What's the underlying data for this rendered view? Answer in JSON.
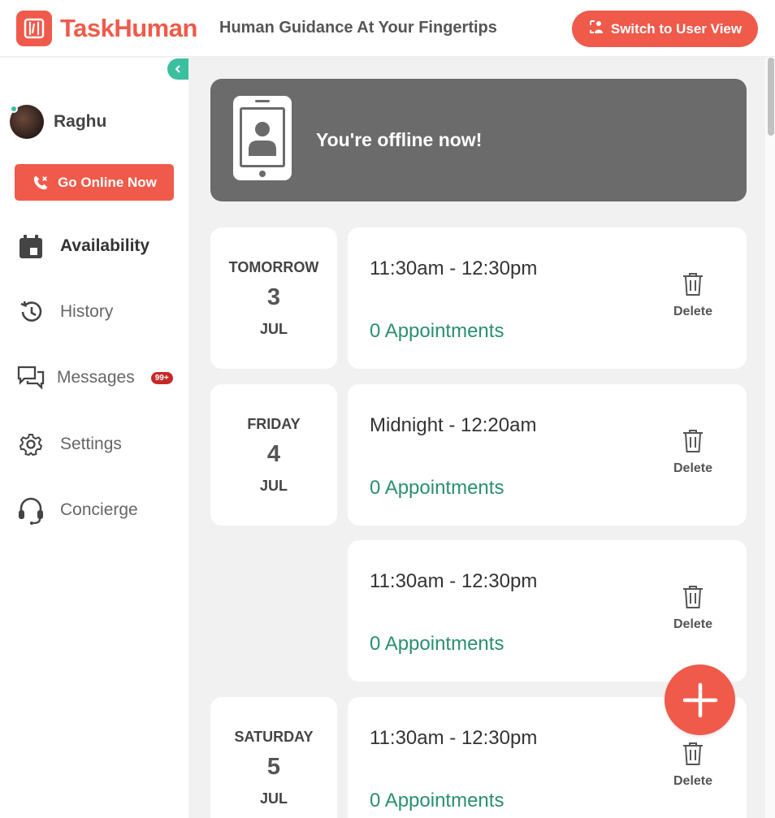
{
  "header": {
    "logo_text": "TaskHuman",
    "tagline": "Human Guidance At Your Fingertips",
    "switch_label": "Switch to User View"
  },
  "sidebar": {
    "user_name": "Raghu",
    "go_online_label": "Go Online Now",
    "nav": [
      {
        "label": "Availability",
        "icon": "calendar-icon",
        "active": true
      },
      {
        "label": "History",
        "icon": "history-icon"
      },
      {
        "label": "Messages",
        "icon": "messages-icon",
        "badge": "99+"
      },
      {
        "label": "Settings",
        "icon": "gear-icon"
      },
      {
        "label": "Concierge",
        "icon": "headset-icon"
      }
    ]
  },
  "main": {
    "offline_text": "You're offline now!",
    "days": [
      {
        "day": "TOMORROW",
        "num": "3",
        "month": "JUL"
      },
      {
        "day": "FRIDAY",
        "num": "4",
        "month": "JUL"
      },
      {
        "day": "SATURDAY",
        "num": "5",
        "month": "JUL"
      }
    ],
    "slots": [
      {
        "time": "11:30am - 12:30pm",
        "appointments": "0 Appointments",
        "delete": "Delete"
      },
      {
        "time": "Midnight - 12:20am",
        "appointments": "0 Appointments",
        "delete": "Delete"
      },
      {
        "time": "11:30am - 12:30pm",
        "appointments": "0 Appointments",
        "delete": "Delete"
      },
      {
        "time": "11:30am - 12:30pm",
        "appointments": "0 Appointments",
        "delete": "Delete"
      }
    ]
  },
  "colors": {
    "brand": "#f05a4a",
    "accent_green": "#3bbf9e",
    "appointments_green": "#2a8f70",
    "banner_gray": "#6b6b6b"
  }
}
